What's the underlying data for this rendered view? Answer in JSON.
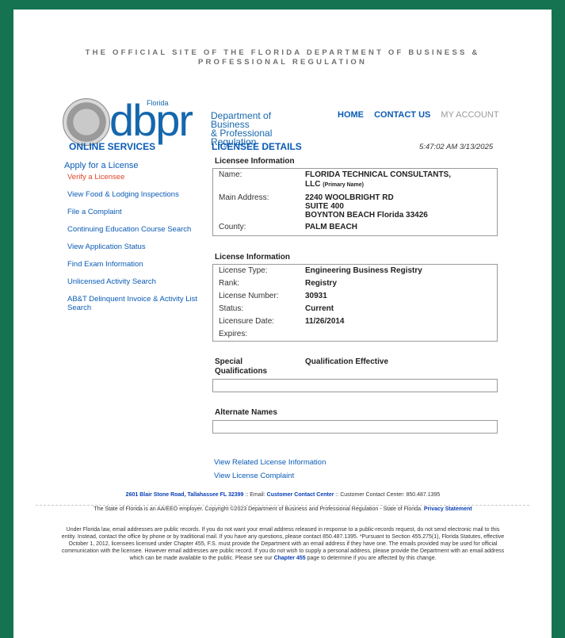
{
  "header": {
    "site_line1": "THE OFFICIAL SITE OF THE FLORIDA DEPARTMENT OF BUSINESS &",
    "site_line2": "PROFESSIONAL REGULATION"
  },
  "logo": {
    "dbpr": "dbpr",
    "florida": "Florida",
    "dept_line1": "Department of Business",
    "dept_line2": "& Professional Regulation"
  },
  "topnav": {
    "home": "HOME",
    "contact": "CONTACT US",
    "account": "MY ACCOUNT"
  },
  "sidebar": {
    "heading": "ONLINE SERVICES",
    "apply": "Apply for a License",
    "items": [
      "Verify a Licensee",
      "View Food & Lodging Inspections",
      "File a Complaint",
      "Continuing Education Course Search",
      "View Application Status",
      "Find Exam Information",
      "Unlicensed Activity Search",
      "AB&T Delinquent Invoice & Activity List Search"
    ]
  },
  "main": {
    "heading": "LICENSEE DETAILS",
    "timestamp": "5:47:02 AM 3/13/2025",
    "licensee_title": "Licensee Information",
    "name_label": "Name:",
    "name_value": "FLORIDA TECHNICAL CONSULTANTS,",
    "name_value2": "LLC",
    "name_note": "(Primary Name)",
    "address_label": "Main Address:",
    "address_1": "2240 WOOLBRIGHT RD",
    "address_2": "SUITE 400",
    "address_3": "BOYNTON BEACH  Florida  33426",
    "county_label": "County:",
    "county_value": "PALM BEACH",
    "license_title": "License Information",
    "type_label": "License Type:",
    "type_value": "Engineering Business Registry",
    "rank_label": "Rank:",
    "rank_value": "Registry",
    "number_label": "License Number:",
    "number_value": "30931",
    "status_label": "Status:",
    "status_value": "Current",
    "date_label": "Licensure Date:",
    "date_value": "11/26/2014",
    "expires_label": "Expires:",
    "special_label": "Special Qualifications",
    "special_value": "Qualification Effective",
    "alternate_title": "Alternate Names",
    "related_link": "View Related License Information",
    "complaint_link": "View License Complaint"
  },
  "footer": {
    "address": "2601 Blair Stone Road, Tallahassee FL 32399",
    "email_prefix": ":: Email:",
    "contact_center": "Customer Contact Center",
    "phone": ":: Customer Contact Center: 850.487.1395",
    "equal": "The State of Florida is an AA/EEO employer. Copyright ©2023 Department of Business and Professional Regulation - State of Florida.",
    "privacy": "Privacy Statement",
    "legal_1": "Under Florida law, email addresses are public records. If you do not want your email address released in response to a public-records request, do not send electronic mail to this entity. Instead, contact the office by phone or by traditional mail. If you have any questions, please contact 850.487.1395. *Pursuant to Section 455.275(1), Florida Statutes, effective October 1, 2012, licensees licensed under Chapter 455, F.S. must provide the Department with an email address if they have one. The emails provided may be used for official communication with the licensee. However email addresses are public record. If you do not wish to supply a personal address, please provide the Department with an email address which can be made available to the public. Please see our",
    "chapter": "Chapter 455",
    "legal_2": "page to determine if you are affected by this change."
  }
}
